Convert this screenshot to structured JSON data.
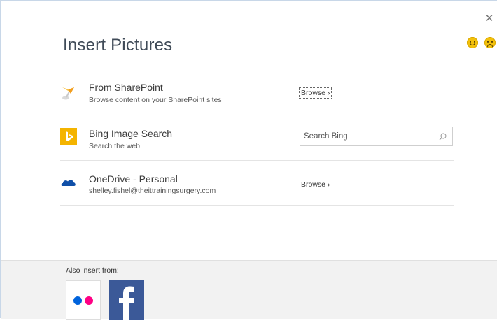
{
  "dialog": {
    "title": "Insert Pictures",
    "close_label": "✕"
  },
  "feedback": {
    "smile_icon": "smile-icon",
    "frown_icon": "frown-icon"
  },
  "sources": [
    {
      "name": "From SharePoint",
      "description": "Browse content on your SharePoint sites",
      "action_label": "Browse ›",
      "icon": "sharepoint-icon"
    },
    {
      "name": "Bing Image Search",
      "description": "Search the web",
      "search_placeholder": "Search Bing",
      "icon": "bing-icon"
    },
    {
      "name": "OneDrive - Personal",
      "description": "shelley.fishel@theittrainingsurgery.com",
      "action_label": "Browse ›",
      "icon": "onedrive-icon"
    }
  ],
  "footer": {
    "label": "Also insert from:",
    "tiles": [
      {
        "name": "Flickr",
        "icon": "flickr-icon"
      },
      {
        "name": "Facebook",
        "icon": "facebook-icon"
      }
    ]
  },
  "colors": {
    "bing": "#f4b400",
    "onedrive": "#0f4fa8",
    "facebook": "#3b5998",
    "flickr_blue": "#0063dc",
    "flickr_pink": "#ff0084",
    "footer_bg": "#f2f2f2"
  }
}
